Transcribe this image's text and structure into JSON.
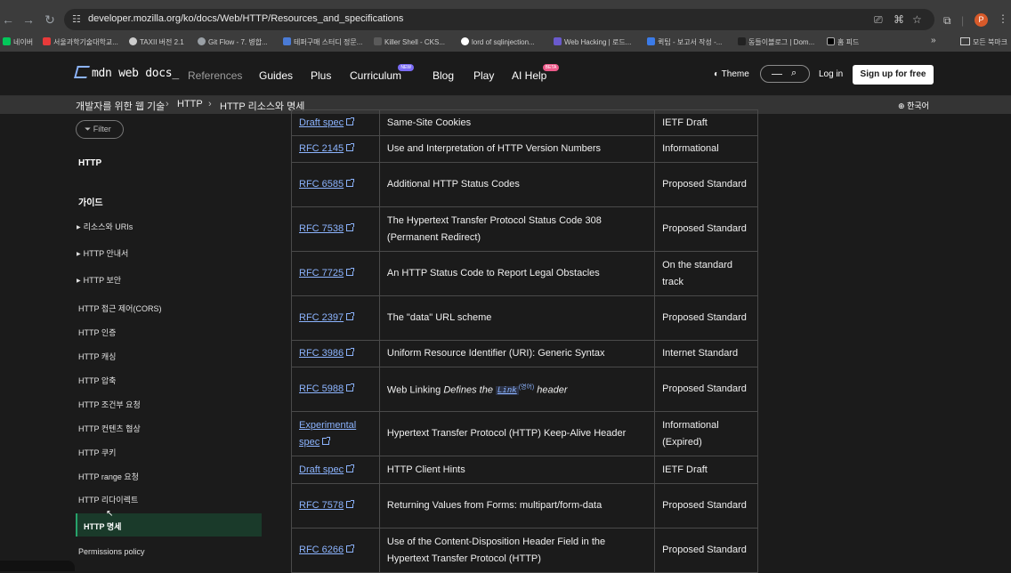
{
  "browser": {
    "url": "developer.mozilla.org/ko/docs/Web/HTTP/Resources_and_specifications",
    "profile_initial": "P",
    "bookmarks": [
      {
        "label": "네이버",
        "color": "#03c75a"
      },
      {
        "label": "서울과학기술대학교...",
        "color": "#e83a3a"
      },
      {
        "label": "TAXII 버전 2.1",
        "color": "#cccccc"
      },
      {
        "label": "Git Flow - 7. 병합...",
        "color": "#9aa0a6"
      },
      {
        "label": "테퍼구매 스터디 정문...",
        "color": "#4a7bd6"
      },
      {
        "label": "Killer Shell - CKS...",
        "color": "#5a5a5a"
      },
      {
        "label": "lord of sqlinjection...",
        "color": "#ffffff"
      },
      {
        "label": "Web Hacking | 로드...",
        "color": "#6a5acd"
      },
      {
        "label": "퀵팁 - 보고서 작성 -...",
        "color": "#3b7be8"
      },
      {
        "label": "동들이블로그 | Dom...",
        "color": "#222222"
      },
      {
        "label": "홈 피드",
        "color": "#000000"
      }
    ],
    "all_bookmarks": "모든 북마크"
  },
  "header": {
    "logo_text": "mdn web docs_",
    "nav": [
      "References",
      "Guides",
      "Plus",
      "Curriculum",
      "Blog",
      "Play",
      "AI Help"
    ],
    "badge_new": "NEW",
    "badge_beta": "BETA",
    "theme": "Theme",
    "login": "Log in",
    "signup": "Sign up for free"
  },
  "breadcrumb": {
    "items": [
      "개발자를 위한 웹 기술",
      "HTTP",
      "HTTP 리소스와 명세"
    ],
    "language": "한국어"
  },
  "sidebar": {
    "filter": "Filter",
    "section": "HTTP",
    "guide_heading": "가이드",
    "expandable": [
      "리소스와 URIs",
      "HTTP 안내서",
      "HTTP 보안"
    ],
    "items": [
      "HTTP 접근 제어(CORS)",
      "HTTP 인증",
      "HTTP 캐싱",
      "HTTP 압축",
      "HTTP 조건부 요청",
      "HTTP 컨텐츠 협상",
      "HTTP 쿠키",
      "HTTP range 요청",
      "HTTP 리다이렉트"
    ],
    "active": "HTTP 명세",
    "after": "Permissions policy"
  },
  "table": {
    "rows": [
      {
        "link": "Draft spec",
        "title": "Same-Site Cookies",
        "status": "IETF Draft"
      },
      {
        "link": "RFC 2145",
        "title": "Use and Interpretation of HTTP Version Numbers",
        "status": "Informational"
      },
      {
        "link": "RFC 6585",
        "title": "Additional HTTP Status Codes",
        "status": "Proposed Standard"
      },
      {
        "link": "RFC 7538",
        "title": "The Hypertext Transfer Protocol Status Code 308 (Permanent Redirect)",
        "status": "Proposed Standard"
      },
      {
        "link": "RFC 7725",
        "title": "An HTTP Status Code to Report Legal Obstacles",
        "status": "On the standard track"
      },
      {
        "link": "RFC 2397",
        "title": "The \"data\" URL scheme",
        "status": "Proposed Standard"
      },
      {
        "link": "RFC 3986",
        "title": "Uniform Resource Identifier (URI): Generic Syntax",
        "status": "Internet Standard"
      },
      {
        "link": "RFC 5988",
        "title_prefix": "Web Linking ",
        "title_italic": "Defines the ",
        "title_code": "Link",
        "title_sup": "(영어)",
        "title_suffix": " header",
        "status": "Proposed Standard"
      },
      {
        "link": "Experimental spec",
        "title": "Hypertext Transfer Protocol (HTTP) Keep-Alive Header",
        "status": "Informational (Expired)"
      },
      {
        "link": "Draft spec",
        "title": "HTTP Client Hints",
        "status": "IETF Draft"
      },
      {
        "link": "RFC 7578",
        "title": "Returning Values from Forms: multipart/form-data",
        "status": "Proposed Standard"
      },
      {
        "link": "RFC 6266",
        "title": "Use of the Content-Disposition Header Field in the Hypertext Transfer Protocol (HTTP)",
        "status": "Proposed Standard"
      }
    ]
  }
}
